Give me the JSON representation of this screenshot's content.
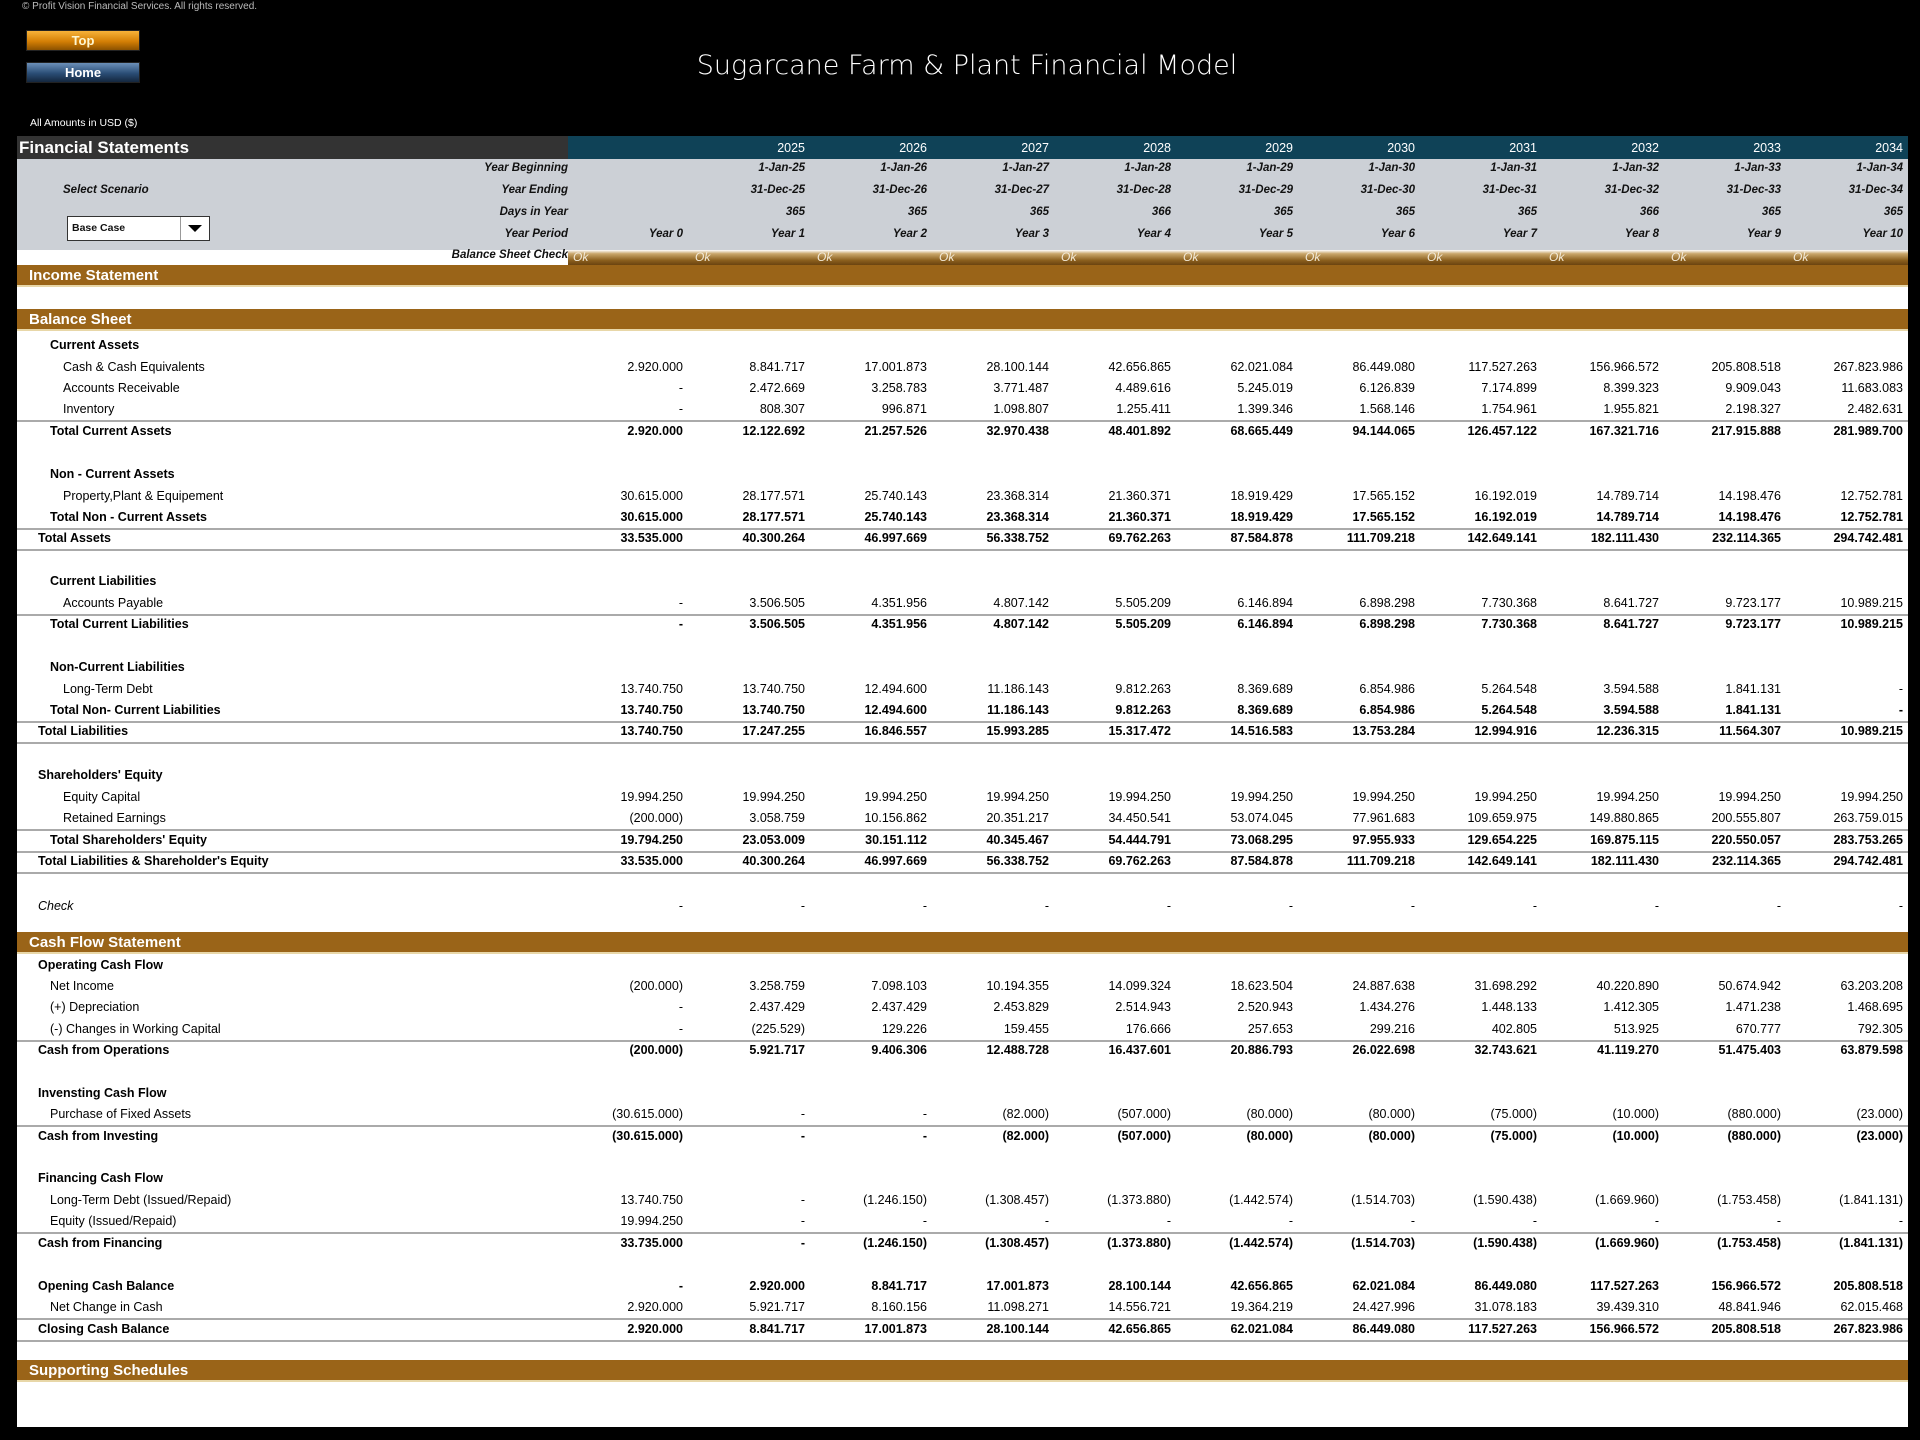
{
  "copyright": "© Profit Vision Financial Services. All rights reserved.",
  "nav": {
    "top_label": "Top",
    "home_label": "Home"
  },
  "title": "Sugarcane Farm & Plant Financial Model",
  "amounts_note": "All Amounts in  USD ($)",
  "header": {
    "title": "Financial Statements",
    "years": [
      "2025",
      "2026",
      "2027",
      "2028",
      "2029",
      "2030",
      "2031",
      "2032",
      "2033",
      "2034"
    ]
  },
  "info": {
    "labels": {
      "year_beginning": "Year Beginning",
      "year_ending": "Year Ending",
      "days_in_year": "Days in Year",
      "year_period": "Year Period",
      "balance_sheet_check": "Balance Sheet Check"
    },
    "select_scenario_label": "Select Scenario",
    "scenario_value": "Base Case",
    "year_beginning": [
      "1-Jan-25",
      "1-Jan-26",
      "1-Jan-27",
      "1-Jan-28",
      "1-Jan-29",
      "1-Jan-30",
      "1-Jan-31",
      "1-Jan-32",
      "1-Jan-33",
      "1-Jan-34"
    ],
    "year_ending": [
      "31-Dec-25",
      "31-Dec-26",
      "31-Dec-27",
      "31-Dec-28",
      "31-Dec-29",
      "31-Dec-30",
      "31-Dec-31",
      "31-Dec-32",
      "31-Dec-33",
      "31-Dec-34"
    ],
    "days_in_year": [
      "365",
      "365",
      "365",
      "366",
      "365",
      "365",
      "365",
      "366",
      "365",
      "365"
    ],
    "year_period": [
      "Year 0",
      "Year 1",
      "Year 2",
      "Year 3",
      "Year 4",
      "Year 5",
      "Year 6",
      "Year 7",
      "Year 8",
      "Year 9",
      "Year 10"
    ],
    "balance_check": [
      "Ok",
      "Ok",
      "Ok",
      "Ok",
      "Ok",
      "Ok",
      "Ok",
      "Ok",
      "Ok",
      "Ok",
      "Ok"
    ]
  },
  "sections": {
    "income_statement": "Income Statement",
    "balance_sheet": "Balance Sheet",
    "cash_flow": "Cash Flow Statement",
    "supporting": "Supporting Schedules"
  },
  "balance_sheet_rows": [
    {
      "label": "Current Assets",
      "values": []
    },
    {
      "label": "Cash & Cash Equivalents",
      "values": [
        "2.920.000",
        "8.841.717",
        "17.001.873",
        "28.100.144",
        "42.656.865",
        "62.021.084",
        "86.449.080",
        "117.527.263",
        "156.966.572",
        "205.808.518",
        "267.823.986"
      ]
    },
    {
      "label": "Accounts Receivable",
      "values": [
        "-",
        "2.472.669",
        "3.258.783",
        "3.771.487",
        "4.489.616",
        "5.245.019",
        "6.126.839",
        "7.174.899",
        "8.399.323",
        "9.909.043",
        "11.683.083"
      ]
    },
    {
      "label": "Inventory",
      "values": [
        "-",
        "808.307",
        "996.871",
        "1.098.807",
        "1.255.411",
        "1.399.346",
        "1.568.146",
        "1.754.961",
        "1.955.821",
        "2.198.327",
        "2.482.631"
      ]
    },
    {
      "label": "Total Current Assets",
      "values": [
        "2.920.000",
        "12.122.692",
        "21.257.526",
        "32.970.438",
        "48.401.892",
        "68.665.449",
        "94.144.065",
        "126.457.122",
        "167.321.716",
        "217.915.888",
        "281.989.700"
      ]
    },
    {
      "label": "Non - Current Assets",
      "values": []
    },
    {
      "label": "Property,Plant & Equipement",
      "values": [
        "30.615.000",
        "28.177.571",
        "25.740.143",
        "23.368.314",
        "21.360.371",
        "18.919.429",
        "17.565.152",
        "16.192.019",
        "14.789.714",
        "14.198.476",
        "12.752.781"
      ]
    },
    {
      "label": "Total Non - Current Assets",
      "values": [
        "30.615.000",
        "28.177.571",
        "25.740.143",
        "23.368.314",
        "21.360.371",
        "18.919.429",
        "17.565.152",
        "16.192.019",
        "14.789.714",
        "14.198.476",
        "12.752.781"
      ]
    },
    {
      "label": "Total Assets",
      "values": [
        "33.535.000",
        "40.300.264",
        "46.997.669",
        "56.338.752",
        "69.762.263",
        "87.584.878",
        "111.709.218",
        "142.649.141",
        "182.111.430",
        "232.114.365",
        "294.742.481"
      ]
    },
    {
      "label": "Current Liabilities",
      "values": []
    },
    {
      "label": "Accounts Payable",
      "values": [
        "-",
        "3.506.505",
        "4.351.956",
        "4.807.142",
        "5.505.209",
        "6.146.894",
        "6.898.298",
        "7.730.368",
        "8.641.727",
        "9.723.177",
        "10.989.215"
      ]
    },
    {
      "label": "Total Current Liabilities",
      "values": [
        "-",
        "3.506.505",
        "4.351.956",
        "4.807.142",
        "5.505.209",
        "6.146.894",
        "6.898.298",
        "7.730.368",
        "8.641.727",
        "9.723.177",
        "10.989.215"
      ]
    },
    {
      "label": "Non-Current Liabilities",
      "values": []
    },
    {
      "label": "Long-Term Debt",
      "values": [
        "13.740.750",
        "13.740.750",
        "12.494.600",
        "11.186.143",
        "9.812.263",
        "8.369.689",
        "6.854.986",
        "5.264.548",
        "3.594.588",
        "1.841.131",
        "-"
      ]
    },
    {
      "label": "Total Non- Current Liabilities",
      "values": [
        "13.740.750",
        "13.740.750",
        "12.494.600",
        "11.186.143",
        "9.812.263",
        "8.369.689",
        "6.854.986",
        "5.264.548",
        "3.594.588",
        "1.841.131",
        "-"
      ]
    },
    {
      "label": "Total Liabilities",
      "values": [
        "13.740.750",
        "17.247.255",
        "16.846.557",
        "15.993.285",
        "15.317.472",
        "14.516.583",
        "13.753.284",
        "12.994.916",
        "12.236.315",
        "11.564.307",
        "10.989.215"
      ]
    },
    {
      "label": "Shareholders' Equity",
      "values": []
    },
    {
      "label": "Equity Capital",
      "values": [
        "19.994.250",
        "19.994.250",
        "19.994.250",
        "19.994.250",
        "19.994.250",
        "19.994.250",
        "19.994.250",
        "19.994.250",
        "19.994.250",
        "19.994.250",
        "19.994.250"
      ]
    },
    {
      "label": "Retained Earnings",
      "values": [
        "(200.000)",
        "3.058.759",
        "10.156.862",
        "20.351.217",
        "34.450.541",
        "53.074.045",
        "77.961.683",
        "109.659.975",
        "149.880.865",
        "200.555.807",
        "263.759.015"
      ]
    },
    {
      "label": "Total Shareholders' Equity",
      "values": [
        "19.794.250",
        "23.053.009",
        "30.151.112",
        "40.345.467",
        "54.444.791",
        "73.068.295",
        "97.955.933",
        "129.654.225",
        "169.875.115",
        "220.550.057",
        "283.753.265"
      ]
    },
    {
      "label": "Total Liabilities & Shareholder's Equity",
      "values": [
        "33.535.000",
        "40.300.264",
        "46.997.669",
        "56.338.752",
        "69.762.263",
        "87.584.878",
        "111.709.218",
        "142.649.141",
        "182.111.430",
        "232.114.365",
        "294.742.481"
      ]
    },
    {
      "label": "Check",
      "values": [
        "-",
        "-",
        "-",
        "-",
        "-",
        "-",
        "-",
        "-",
        "-",
        "-",
        "-"
      ]
    }
  ],
  "cash_flow_rows": [
    {
      "label": "Operating Cash Flow",
      "values": []
    },
    {
      "label": "Net Income",
      "values": [
        "(200.000)",
        "3.258.759",
        "7.098.103",
        "10.194.355",
        "14.099.324",
        "18.623.504",
        "24.887.638",
        "31.698.292",
        "40.220.890",
        "50.674.942",
        "63.203.208"
      ]
    },
    {
      "label": "(+) Depreciation",
      "values": [
        "-",
        "2.437.429",
        "2.437.429",
        "2.453.829",
        "2.514.943",
        "2.520.943",
        "1.434.276",
        "1.448.133",
        "1.412.305",
        "1.471.238",
        "1.468.695"
      ]
    },
    {
      "label": "(-) Changes in Working Capital",
      "values": [
        "-",
        "(225.529)",
        "129.226",
        "159.455",
        "176.666",
        "257.653",
        "299.216",
        "402.805",
        "513.925",
        "670.777",
        "792.305"
      ]
    },
    {
      "label": "Cash from Operations",
      "values": [
        "(200.000)",
        "5.921.717",
        "9.406.306",
        "12.488.728",
        "16.437.601",
        "20.886.793",
        "26.022.698",
        "32.743.621",
        "41.119.270",
        "51.475.403",
        "63.879.598"
      ]
    },
    {
      "label": "Invensting Cash Flow",
      "values": []
    },
    {
      "label": "Purchase of Fixed Assets",
      "values": [
        "(30.615.000)",
        "-",
        "-",
        "(82.000)",
        "(507.000)",
        "(80.000)",
        "(80.000)",
        "(75.000)",
        "(10.000)",
        "(880.000)",
        "(23.000)"
      ]
    },
    {
      "label": "Cash from Investing",
      "values": [
        "(30.615.000)",
        "-",
        "-",
        "(82.000)",
        "(507.000)",
        "(80.000)",
        "(80.000)",
        "(75.000)",
        "(10.000)",
        "(880.000)",
        "(23.000)"
      ]
    },
    {
      "label": "Financing Cash Flow",
      "values": []
    },
    {
      "label": "Long-Term Debt (Issued/Repaid)",
      "values": [
        "13.740.750",
        "-",
        "(1.246.150)",
        "(1.308.457)",
        "(1.373.880)",
        "(1.442.574)",
        "(1.514.703)",
        "(1.590.438)",
        "(1.669.960)",
        "(1.753.458)",
        "(1.841.131)"
      ]
    },
    {
      "label": "Equity (Issued/Repaid)",
      "values": [
        "19.994.250",
        "-",
        "-",
        "-",
        "-",
        "-",
        "-",
        "-",
        "-",
        "-",
        "-"
      ]
    },
    {
      "label": "Cash from Financing",
      "values": [
        "33.735.000",
        "-",
        "(1.246.150)",
        "(1.308.457)",
        "(1.373.880)",
        "(1.442.574)",
        "(1.514.703)",
        "(1.590.438)",
        "(1.669.960)",
        "(1.753.458)",
        "(1.841.131)"
      ]
    },
    {
      "label": "Opening Cash Balance",
      "values": [
        "-",
        "2.920.000",
        "8.841.717",
        "17.001.873",
        "28.100.144",
        "42.656.865",
        "62.021.084",
        "86.449.080",
        "117.527.263",
        "156.966.572",
        "205.808.518"
      ]
    },
    {
      "label": "Net Change in Cash",
      "values": [
        "2.920.000",
        "5.921.717",
        "8.160.156",
        "11.098.271",
        "14.556.721",
        "19.364.219",
        "24.427.996",
        "31.078.183",
        "39.439.310",
        "48.841.946",
        "62.015.468"
      ]
    },
    {
      "label": "Closing Cash Balance",
      "values": [
        "2.920.000",
        "8.841.717",
        "17.001.873",
        "28.100.144",
        "42.656.865",
        "62.021.084",
        "86.449.080",
        "117.527.263",
        "156.966.572",
        "205.808.518",
        "267.823.986"
      ]
    }
  ]
}
